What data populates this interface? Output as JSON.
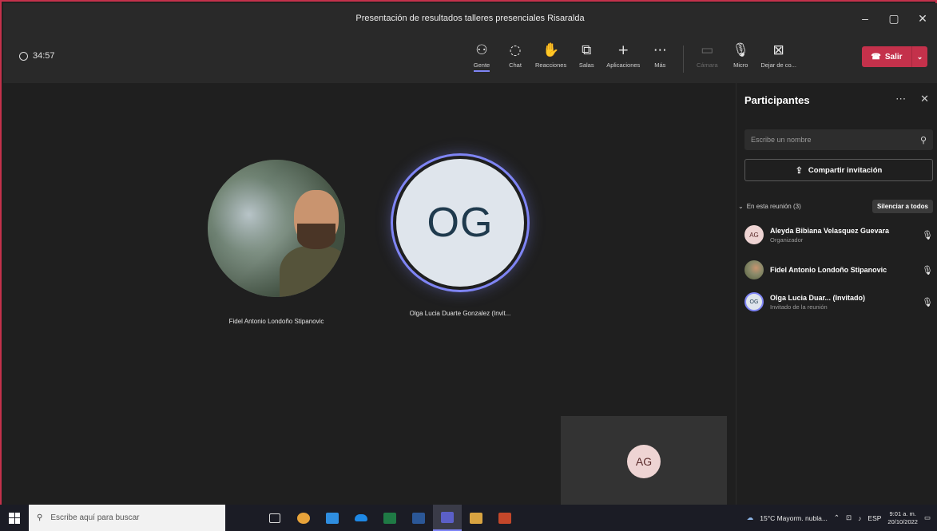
{
  "window": {
    "title": "Presentación de resultados talleres presenciales Risaralda"
  },
  "toolbar": {
    "timer": "34:57",
    "items": [
      {
        "label": "Gente",
        "icon": "people-icon",
        "active": true
      },
      {
        "label": "Chat",
        "icon": "chat-icon"
      },
      {
        "label": "Reacciones",
        "icon": "reactions-icon"
      },
      {
        "label": "Salas",
        "icon": "rooms-icon"
      },
      {
        "label": "Aplicaciones",
        "icon": "plus-icon"
      },
      {
        "label": "Más",
        "icon": "more-icon"
      }
    ],
    "media": [
      {
        "label": "Cámara",
        "icon": "camera-icon",
        "disabled": true
      },
      {
        "label": "Micro",
        "icon": "mic-icon"
      },
      {
        "label": "Dejar de co...",
        "icon": "stop-share-icon"
      }
    ],
    "leave_label": "Salir"
  },
  "stage": {
    "participants": [
      {
        "name": "Fidel Antonio Londoño Stipanovic",
        "avatar": "photo"
      },
      {
        "name": "Olga Lucia Duarte Gonzalez (Invit...",
        "initials": "OG"
      }
    ],
    "self_view_initials": "AG"
  },
  "panel": {
    "title": "Participantes",
    "search_placeholder": "Escribe un nombre",
    "share_label": "Compartir invitación",
    "section_label": "En esta reunión (3)",
    "mute_all_label": "Silenciar a todos",
    "people": [
      {
        "initials": "AG",
        "name": "Aleyda Bibiana Velasquez Guevara",
        "role": "Organizador",
        "kind": "ag"
      },
      {
        "initials": "",
        "name": "Fidel Antonio Londoño Stipanovic",
        "role": "",
        "kind": "photo"
      },
      {
        "initials": "OG",
        "name": "Olga Lucia Duar... (Invitado)",
        "role": "Invitado de la reunión",
        "kind": "og"
      }
    ]
  },
  "taskbar": {
    "search_placeholder": "Escribe aquí para buscar",
    "weather": "15°C  Mayorm. nubla...",
    "language": "ESP",
    "time": "9:01 a. m.",
    "date": "20/10/2022"
  },
  "colors": {
    "accent": "#7f85f5",
    "leave": "#c4314b",
    "frame": "#c4314b"
  }
}
